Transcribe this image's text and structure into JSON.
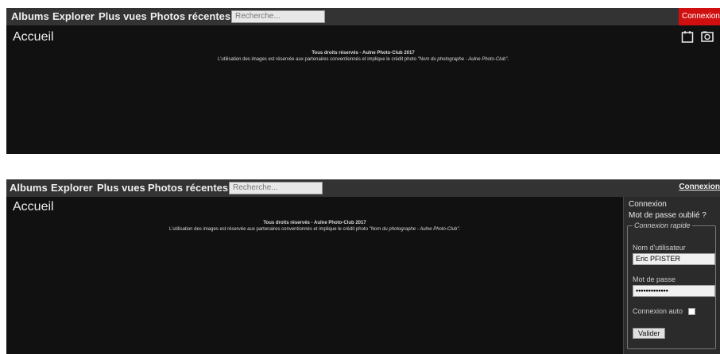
{
  "nav": {
    "albums": "Albums",
    "explorer": "Explorer",
    "plus_vues": "Plus vues",
    "photos_recentes": "Photos récentes",
    "search_placeholder": "Recherche...",
    "connexion": "Connexion"
  },
  "page": {
    "title": "Accueil",
    "copyright": "Tous droits réservés - Aulne Photo-Club 2017",
    "usage_text": "L'utilisation des images est réservée aux partenaires conventionnés et implique le crédit photo ",
    "usage_credit": "\"Nom du photographe - Aulne Photo-Club\"."
  },
  "login_panel": {
    "connexion": "Connexion",
    "forgot": "Mot de passe oublié ?",
    "legend": "Connexion rapide",
    "username_label": "Nom d'utilisateur",
    "username_value": "Eric PFISTER",
    "password_label": "Mot de passe",
    "password_value": "•••••••••••••",
    "auto_label": "Connexion auto",
    "submit": "Valider"
  },
  "colors": {
    "background": "#111111",
    "menubar": "#333333",
    "login_highlight": "#d01010"
  },
  "icons": [
    "calendar-icon",
    "camera-icon"
  ]
}
